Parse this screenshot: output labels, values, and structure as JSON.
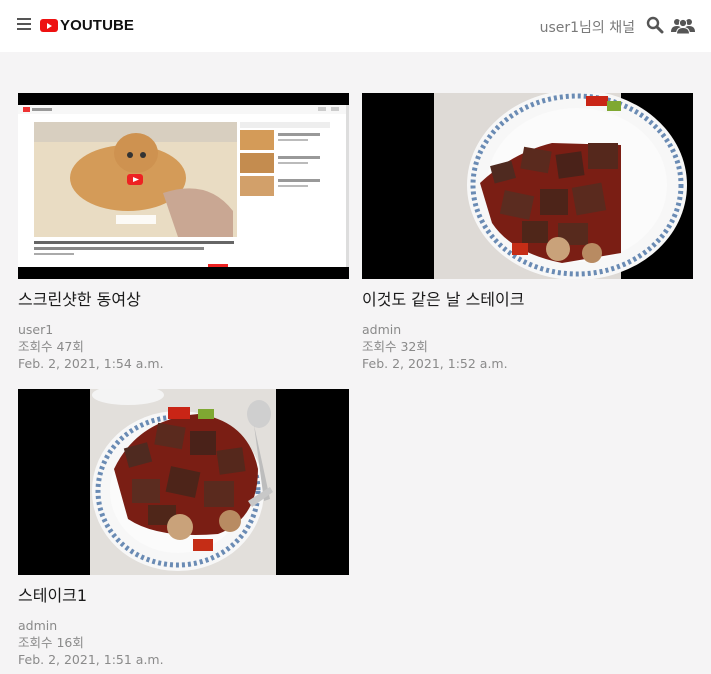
{
  "header": {
    "logo_text": "YOUTUBE",
    "channel_label": "user1님의 채널",
    "menu_icon": "hamburger-icon",
    "search_icon": "search-icon",
    "users_icon": "users-icon",
    "logo_color": "#ee1111"
  },
  "videos": [
    {
      "title": "스크린샷한 동여상",
      "author": "user1",
      "views": "조회수 47회",
      "date": "Feb. 2, 2021, 1:54 a.m.",
      "thumbnail": "screenshot-of-youtube-page-with-cat"
    },
    {
      "title": "이것도 같은 날 스테이크",
      "author": "admin",
      "views": "조회수 32회",
      "date": "Feb. 2, 2021, 1:52 a.m.",
      "thumbnail": "steak-plate-closeup"
    },
    {
      "title": "스테이크1",
      "author": "admin",
      "views": "조회수 16회",
      "date": "Feb. 2, 2021, 1:51 a.m.",
      "thumbnail": "steak-plate-with-fork"
    }
  ]
}
